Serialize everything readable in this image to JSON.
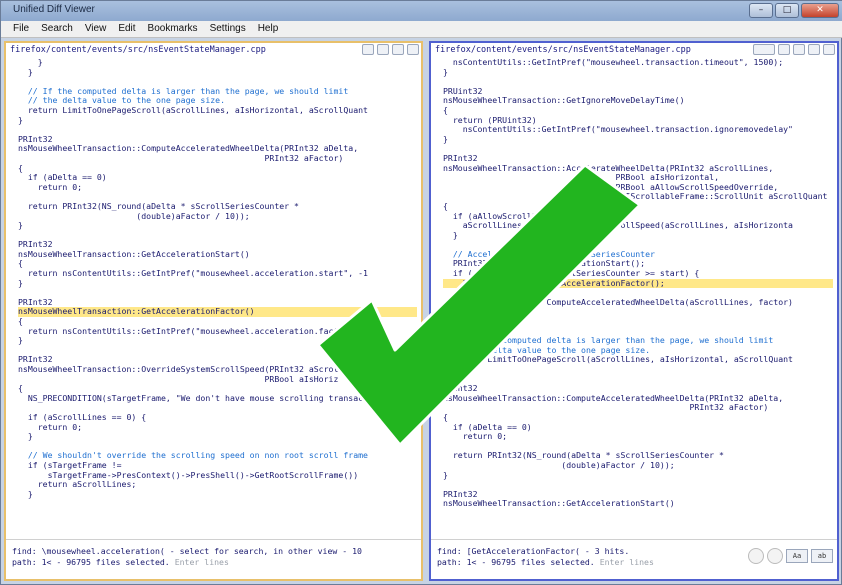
{
  "window": {
    "title": "Unified Diff Viewer"
  },
  "menu": [
    "File",
    "Search",
    "View",
    "Edit",
    "Bookmarks",
    "Settings",
    "Help"
  ],
  "left_pane": {
    "path": "firefox/content/events/src/nsEventStateManager.cpp",
    "lines": [
      {
        "t": "    }"
      },
      {
        "t": "  }"
      },
      {
        "t": ""
      },
      {
        "t": "  // If the computed delta is larger than the page, we should limit",
        "c": 1
      },
      {
        "t": "  // the delta value to the one page size.",
        "c": 1
      },
      {
        "t": "  return LimitToOnePageScroll(aScrollLines, aIsHorizontal, aScrollQuant"
      },
      {
        "t": "}"
      },
      {
        "t": ""
      },
      {
        "t": "PRInt32"
      },
      {
        "t": "nsMouseWheelTransaction::ComputeAcceleratedWheelDelta(PRInt32 aDelta,"
      },
      {
        "t": "                                                  PRInt32 aFactor)"
      },
      {
        "t": "{"
      },
      {
        "t": "  if (aDelta == 0)"
      },
      {
        "t": "    return 0;"
      },
      {
        "t": ""
      },
      {
        "t": "  return PRInt32(NS_round(aDelta * sScrollSeriesCounter *"
      },
      {
        "t": "                        (double)aFactor / 10));"
      },
      {
        "t": "}"
      },
      {
        "t": ""
      },
      {
        "t": "PRInt32"
      },
      {
        "t": "nsMouseWheelTransaction::GetAccelerationStart()"
      },
      {
        "t": "{"
      },
      {
        "t": "  return nsContentUtils::GetIntPref(\"mousewheel.acceleration.start\", -1"
      },
      {
        "t": "}"
      },
      {
        "t": ""
      },
      {
        "t": "PRInt32"
      },
      {
        "t": "nsMouseWheelTransaction::GetAccelerationFactor()",
        "h": 1
      },
      {
        "t": "{"
      },
      {
        "t": "  return nsContentUtils::GetIntPref(\"mousewheel.acceleration.factor\","
      },
      {
        "t": "}"
      },
      {
        "t": ""
      },
      {
        "t": "PRInt32"
      },
      {
        "t": "nsMouseWheelTransaction::OverrideSystemScrollSpeed(PRInt32 aScrollLin"
      },
      {
        "t": "                                                  PRBool aIsHoriz"
      },
      {
        "t": "{"
      },
      {
        "t": "  NS_PRECONDITION(sTargetFrame, \"We don't have mouse scrolling transact"
      },
      {
        "t": ""
      },
      {
        "t": "  if (aScrollLines == 0) {"
      },
      {
        "t": "    return 0;"
      },
      {
        "t": "  }"
      },
      {
        "t": ""
      },
      {
        "t": "  // We shouldn't override the scrolling speed on non root scroll frame",
        "c": 1
      },
      {
        "t": "  if (sTargetFrame !="
      },
      {
        "t": "      sTargetFrame->PresContext()->PresShell()->GetRootScrollFrame())"
      },
      {
        "t": "    return aScrollLines;"
      },
      {
        "t": "  }"
      }
    ],
    "status_find": "find: \\mousewheel.acceleration( - select for search, in other view - 10",
    "status_path": "path: 1< - 96795 files selected.",
    "status_hint": "Enter lines"
  },
  "right_pane": {
    "path": "firefox/content/events/src/nsEventStateManager.cpp",
    "lines": [
      {
        "t": "  nsContentUtils::GetIntPref(\"mousewheel.transaction.timeout\", 1500);"
      },
      {
        "t": "}"
      },
      {
        "t": ""
      },
      {
        "t": "PRUint32"
      },
      {
        "t": "nsMouseWheelTransaction::GetIgnoreMoveDelayTime()"
      },
      {
        "t": "{"
      },
      {
        "t": "  return (PRUint32)"
      },
      {
        "t": "    nsContentUtils::GetIntPref(\"mousewheel.transaction.ignoremovedelay\""
      },
      {
        "t": "}"
      },
      {
        "t": ""
      },
      {
        "t": "PRInt32"
      },
      {
        "t": "nsMouseWheelTransaction::AccelerateWheelDelta(PRInt32 aScrollLines,"
      },
      {
        "t": "                                   PRBool aIsHorizontal,"
      },
      {
        "t": "                                   PRBool aAllowScrollSpeedOverride,"
      },
      {
        "t": "                                   nsIScrollableFrame::ScrollUnit aScrollQuant"
      },
      {
        "t": "{"
      },
      {
        "t": "  if (aAllowScrollSpeedOverride) {"
      },
      {
        "t": "    aScrollLines = OverrideSystemScrollSpeed(aScrollLines, aIsHorizonta"
      },
      {
        "t": "  }"
      },
      {
        "t": ""
      },
      {
        "t": "  // Accelerate by the sScrollSeriesCounter",
        "c": 1
      },
      {
        "t": "  PRInt32 start = GetAccelerationStart();"
      },
      {
        "t": "  if (start >= 0 && sScrollSeriesCounter >= start) {"
      },
      {
        "t": "    PRInt32 factor = GetAccelerationFactor();",
        "h": 1
      },
      {
        "t": "    if (factor > 0) {"
      },
      {
        "t": "      aScrollLines = ComputeAcceleratedWheelDelta(aScrollLines, factor)"
      },
      {
        "t": "    }"
      },
      {
        "t": "  }"
      },
      {
        "t": ""
      },
      {
        "t": "  // If the computed delta is larger than the page, we should limit",
        "c": 1
      },
      {
        "t": "  // the delta value to the one page size.",
        "c": 1
      },
      {
        "t": "  return LimitToOnePageScroll(aScrollLines, aIsHorizontal, aScrollQuant"
      },
      {
        "t": "}"
      },
      {
        "t": ""
      },
      {
        "t": "PRInt32"
      },
      {
        "t": "nsMouseWheelTransaction::ComputeAcceleratedWheelDelta(PRInt32 aDelta,"
      },
      {
        "t": "                                                  PRInt32 aFactor)"
      },
      {
        "t": "{"
      },
      {
        "t": "  if (aDelta == 0)"
      },
      {
        "t": "    return 0;"
      },
      {
        "t": ""
      },
      {
        "t": "  return PRInt32(NS_round(aDelta * sScrollSeriesCounter *"
      },
      {
        "t": "                        (double)aFactor / 10));"
      },
      {
        "t": "}"
      },
      {
        "t": ""
      },
      {
        "t": "PRInt32"
      },
      {
        "t": "nsMouseWheelTransaction::GetAccelerationStart()"
      }
    ],
    "status_find": "find: [GetAccelerationFactor( - 3 hits.",
    "status_path": "path: 1< - 96795 files selected.",
    "status_hint": "Enter lines",
    "aa_label": "Aa",
    "ab_label": "ab"
  },
  "overlay": {
    "icon": "checkmark-icon",
    "color": "#22b51f"
  }
}
